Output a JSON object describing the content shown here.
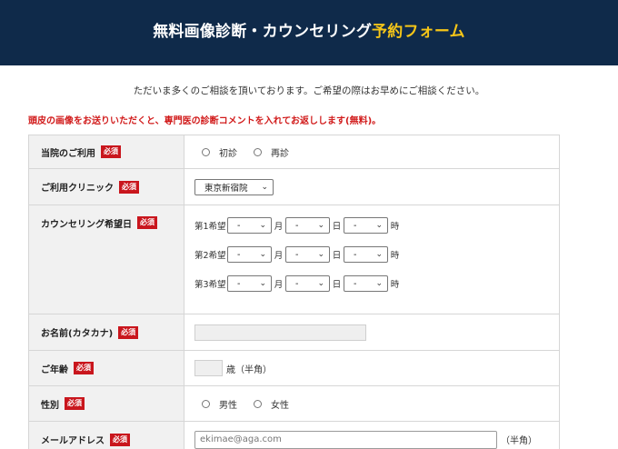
{
  "header": {
    "title_main": "無料画像診断・カウンセリング",
    "title_accent": "予約フォーム"
  },
  "intro": "ただいま多くのご相談を頂いております。ご希望の際はお早めにご相談ください。",
  "notice": "頭皮の画像をお送りいただくと、専門医の診断コメントを入れてお返しします(無料)。",
  "required_badge": "必須",
  "fields": {
    "visit": {
      "label": "当院のご利用",
      "options": [
        "初診",
        "再診"
      ]
    },
    "clinic": {
      "label": "ご利用クリニック",
      "selected": "東京新宿院"
    },
    "counseling": {
      "label": "カウンセリング希望日",
      "choices": [
        "第1希望",
        "第2希望",
        "第3希望"
      ],
      "empty_option": "-",
      "month_unit": "月",
      "day_unit": "日",
      "hour_unit": "時"
    },
    "name": {
      "label": "お名前(カタカナ)"
    },
    "age": {
      "label": "ご年齢",
      "suffix": "歳（半角）"
    },
    "gender": {
      "label": "性別",
      "options": [
        "男性",
        "女性"
      ]
    },
    "email": {
      "label": "メールアドレス",
      "placeholder": "ekimae@aga.com",
      "suffix": "（半角）"
    }
  }
}
